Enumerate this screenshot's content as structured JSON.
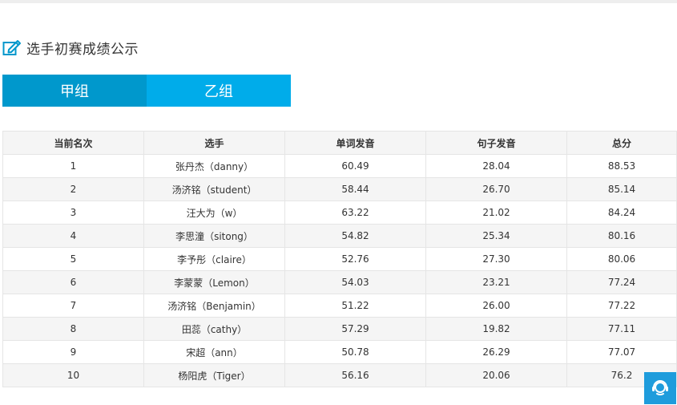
{
  "section": {
    "title": "选手初赛成绩公示",
    "icon": "edit-icon"
  },
  "tabs": [
    {
      "label": "甲组",
      "active": true
    },
    {
      "label": "乙组",
      "active": false
    }
  ],
  "table": {
    "headers": [
      "当前名次",
      "选手",
      "单词发音",
      "句子发音",
      "总分"
    ],
    "rows": [
      {
        "rank": "1",
        "name": "张丹杰（danny）",
        "word": "60.49",
        "sentence": "28.04",
        "total": "88.53"
      },
      {
        "rank": "2",
        "name": "汤济铭（student）",
        "word": "58.44",
        "sentence": "26.70",
        "total": "85.14"
      },
      {
        "rank": "3",
        "name": "汪大为（w）",
        "word": "63.22",
        "sentence": "21.02",
        "total": "84.24"
      },
      {
        "rank": "4",
        "name": "李思潼（sitong）",
        "word": "54.82",
        "sentence": "25.34",
        "total": "80.16"
      },
      {
        "rank": "5",
        "name": "李予彤（claire）",
        "word": "52.76",
        "sentence": "27.30",
        "total": "80.06"
      },
      {
        "rank": "6",
        "name": "李蒙蒙（Lemon）",
        "word": "54.03",
        "sentence": "23.21",
        "total": "77.24"
      },
      {
        "rank": "7",
        "name": "汤济铭（Benjamin）",
        "word": "51.22",
        "sentence": "26.00",
        "total": "77.22"
      },
      {
        "rank": "8",
        "name": "田蕊（cathy）",
        "word": "57.29",
        "sentence": "19.82",
        "total": "77.11"
      },
      {
        "rank": "9",
        "name": "宋超（ann）",
        "word": "50.78",
        "sentence": "26.29",
        "total": "77.07"
      },
      {
        "rank": "10",
        "name": "杨阳虎（Tiger）",
        "word": "56.16",
        "sentence": "20.06",
        "total": "76.2"
      }
    ]
  },
  "support": {
    "icon": "customer-service-icon"
  },
  "colors": {
    "tab_active": "#0098cc",
    "tab_inactive": "#00acea",
    "support_button": "#1e9cdc"
  }
}
